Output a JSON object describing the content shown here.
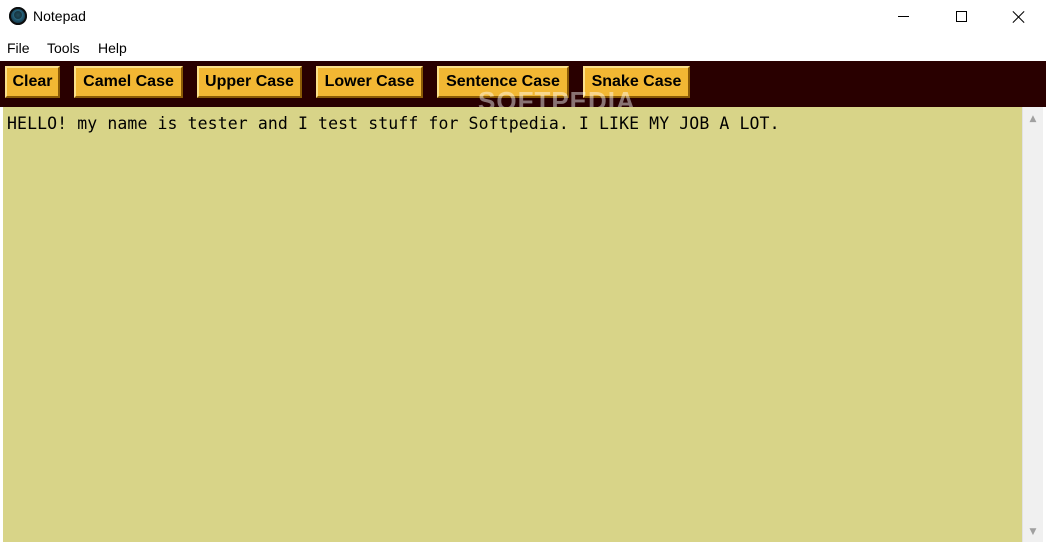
{
  "window": {
    "title": "Notepad",
    "controls": {
      "minimize": "minimize-icon",
      "maximize": "maximize-icon",
      "close": "close-icon"
    }
  },
  "menu": {
    "items": [
      {
        "label": "File"
      },
      {
        "label": "Tools"
      },
      {
        "label": "Help"
      }
    ]
  },
  "toolbar": {
    "buttons": [
      {
        "label": "Clear"
      },
      {
        "label": "Camel Case"
      },
      {
        "label": "Upper Case"
      },
      {
        "label": "Lower Case"
      },
      {
        "label": "Sentence Case"
      },
      {
        "label": "Snake Case"
      }
    ],
    "watermark": "SOFTPEDIA",
    "colors": {
      "background": "#290000",
      "button": "#f2b733"
    }
  },
  "editor": {
    "content": "HELLO! my name is tester and I test stuff for Softpedia. I LIKE MY JOB A LOT.",
    "background": "#d8d488"
  }
}
